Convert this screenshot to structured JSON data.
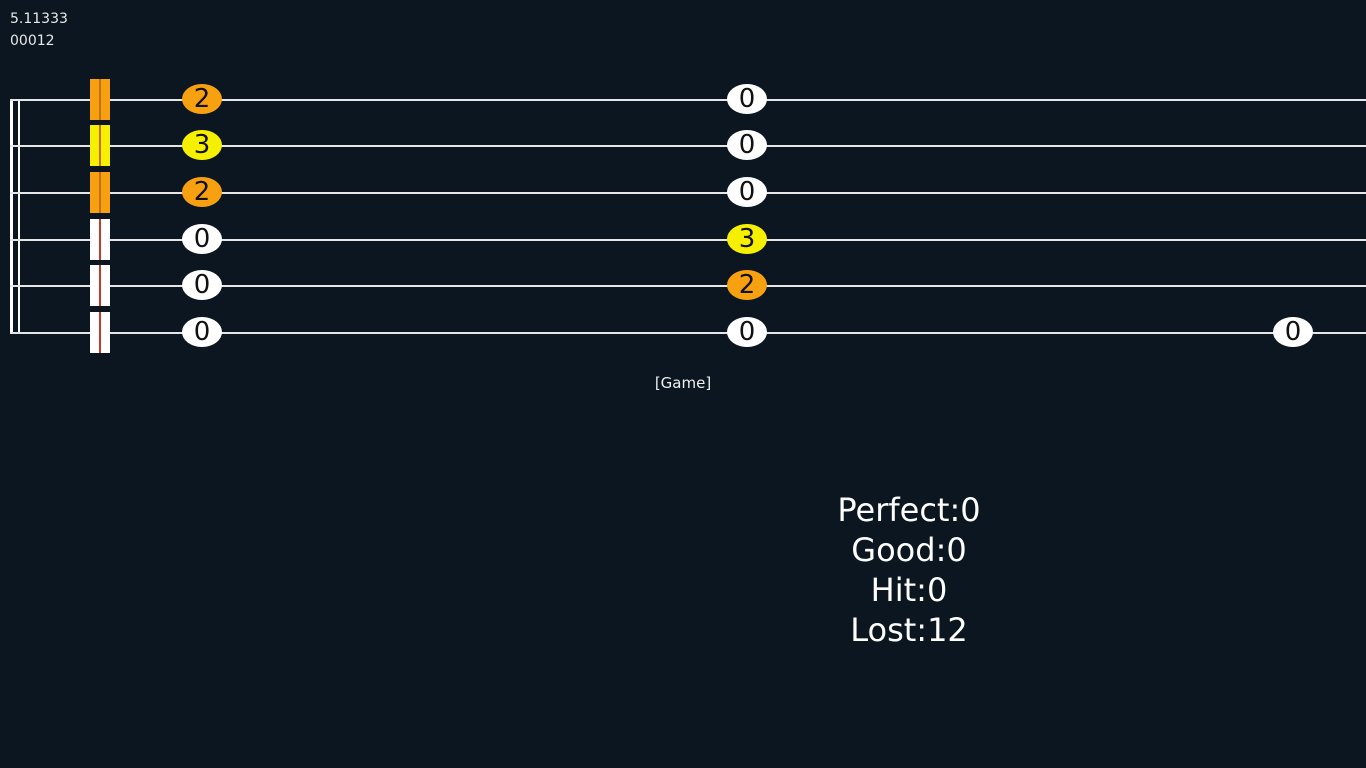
{
  "hud": {
    "time": "5.11333",
    "frame": "00012"
  },
  "colors": {
    "background": "#0c1620",
    "line": "#e6e6e6",
    "fret_0": "#ffffff",
    "fret_2": "#f7a010",
    "fret_3": "#f6f000",
    "marker_line": "#c0392b"
  },
  "strings": [
    {
      "marker_color": "orange"
    },
    {
      "marker_color": "yellow"
    },
    {
      "marker_color": "orange"
    },
    {
      "marker_color": "white"
    },
    {
      "marker_color": "white"
    },
    {
      "marker_color": "white"
    }
  ],
  "notes": [
    {
      "string": 1,
      "beat": 1,
      "fret": "2"
    },
    {
      "string": 2,
      "beat": 1,
      "fret": "3"
    },
    {
      "string": 3,
      "beat": 1,
      "fret": "2"
    },
    {
      "string": 4,
      "beat": 1,
      "fret": "0"
    },
    {
      "string": 5,
      "beat": 1,
      "fret": "0"
    },
    {
      "string": 6,
      "beat": 1,
      "fret": "0"
    },
    {
      "string": 1,
      "beat": 2,
      "fret": "0"
    },
    {
      "string": 2,
      "beat": 2,
      "fret": "0"
    },
    {
      "string": 3,
      "beat": 2,
      "fret": "0"
    },
    {
      "string": 4,
      "beat": 2,
      "fret": "3"
    },
    {
      "string": 5,
      "beat": 2,
      "fret": "2"
    },
    {
      "string": 6,
      "beat": 2,
      "fret": "0"
    },
    {
      "string": 6,
      "beat": 3,
      "fret": "0"
    }
  ],
  "game_label": "[Game]",
  "stats": {
    "perfect": "Perfect:0",
    "good": "Good:0",
    "hit": "Hit:0",
    "lost": "Lost:12"
  }
}
